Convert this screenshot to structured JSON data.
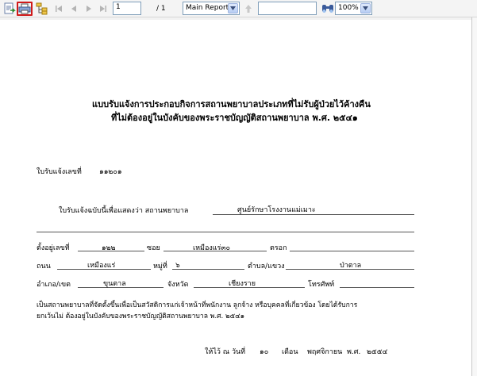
{
  "toolbar": {
    "page_current": "1",
    "page_total": "/ 1",
    "report_select": "Main Report",
    "find_value": "",
    "zoom": "100%",
    "icons": [
      "export-icon",
      "print-icon",
      "group-tree-icon",
      "first-page-icon",
      "prev-page-icon",
      "next-page-icon",
      "last-page-icon",
      "drill-up-icon",
      "find-icon"
    ]
  },
  "document": {
    "title_line1": "แบบรับแจ้งการประกอบกิจการสถานพยาบาลประเภทที่ไม่รับผู้ป่วยไว้ค้างคืน",
    "title_line2": "ที่ไม่ต้องอยู่ในบังคับของพระราชบัญญัติสถานพยาบาล พ.ศ. ๒๕๔๑",
    "receipt_no_label": "ใบรับแจ้งเลขที่",
    "receipt_no_value": "๑๑๒๐๑",
    "certify_label": "ใบรับแจ้งฉบับนี้เพื่อแสดงว่า สถานพยาบาล",
    "facility_name": "ศูนย์รักษาโรงงานแม่เมาะ",
    "address_no_label": "ตั้งอยู่เลขที่",
    "address_no": "๑๒๒",
    "soi_label": "ซอย",
    "soi": "เหมืองแร่๓๐",
    "trok_label": "ตรอก",
    "trok": "",
    "road_label": "ถนน",
    "road": "เหมืองแร่",
    "moo_label": "หมู่ที่",
    "moo": "๖",
    "tambon_label": "ตำบล/แขวง",
    "tambon": "ป่าตาล",
    "amphoe_label": "อำเภอ/เขต",
    "amphoe": "ขุนตาล",
    "province_label": "จังหวัด",
    "province": "เชียงราย",
    "phone_label": "โทรศัพท์",
    "phone": "",
    "body_line1": "เป็นสถานพยาบาลที่จัดตั้งขึ้นเพื่อเป็นสวัสดิการแก่เจ้าหน้าที่พนักงาน ลูกจ้าง หรือบุคคลที่เกี่ยวข้อง โดยได้รับการ",
    "body_line2": "ยกเว้นไม่ ต้องอยู่ในบังคับของพระราชบัญญัติสถานพยาบาล พ.ศ. ๒๕๔๑",
    "given_label": "ให้ไว้ ณ วันที่",
    "day": "๑๐",
    "month_label": "เดือน",
    "month": "พฤศจิกายน",
    "year_label": "พ.ศ.",
    "year": "๒๕๕๔"
  }
}
